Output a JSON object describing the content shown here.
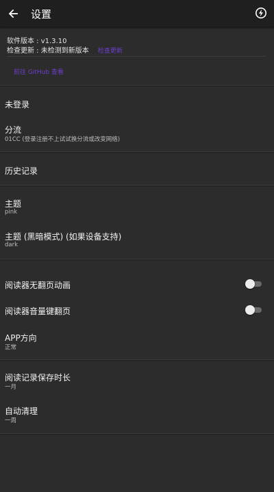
{
  "appbar": {
    "title": "设置",
    "back_icon": "arrow-left-icon",
    "action_icon": "lightning-circle-icon"
  },
  "version": {
    "label": "软件版本 : v1.3.10",
    "check_label": "检查更新 : 未检测到新版本",
    "check_link": "检查更新",
    "release_link": "前往 GitHub 查看"
  },
  "items": {
    "login": {
      "label": "未登录"
    },
    "branch": {
      "label": "分流",
      "sub": "01CC (登录注册不上试试换分流或改变网络)"
    },
    "history": {
      "label": "历史记录"
    },
    "theme": {
      "label": "主题",
      "sub": "pink"
    },
    "dark_theme": {
      "label": "主题 (黑暗模式) (如果设备支持)",
      "sub": "dark"
    },
    "no_anim": {
      "label": "阅读器无翻页动画",
      "toggle_on": false
    },
    "volume_keys": {
      "label": "阅读器音量键翻页",
      "toggle_on": false
    },
    "orientation": {
      "label": "APP方向",
      "sub": "正常"
    },
    "history_keep": {
      "label": "阅读记录保存时长",
      "sub": "一月"
    },
    "auto_clean": {
      "label": "自动清理",
      "sub": "一周"
    }
  },
  "colors": {
    "background": "#2c2c2c",
    "appbar": "#1f1f1f",
    "accent_link": "#6a3fc9",
    "text_primary": "#f2f2f2",
    "text_secondary": "#bdbdbd"
  }
}
